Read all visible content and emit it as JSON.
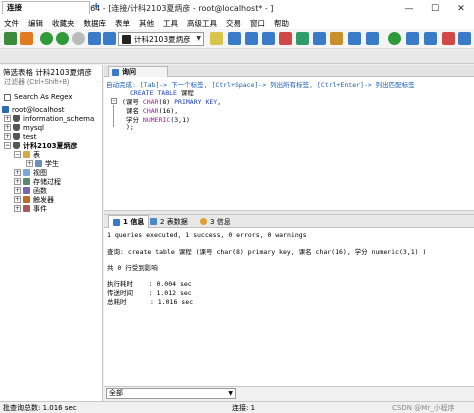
{
  "window": {
    "title": "SQLyog Ultimate 64 - [连接/计科2103夏炳彦 - root@localhost* - ]",
    "minimize": "—",
    "maximize": "☐",
    "close": "✕"
  },
  "menu": [
    "文件",
    "编辑",
    "收藏夹",
    "数据库",
    "表单",
    "其他",
    "工具",
    "高级工具",
    "交易",
    "窗口",
    "帮助"
  ],
  "toolbar": {
    "database_selected": "计科2103夏炳彦"
  },
  "connection_tab": {
    "label": "连接",
    "add": "+"
  },
  "object_browser": {
    "filter_label": "筛选表格 计科2103夏炳彦",
    "filter_placeholder": "过滤器 (Ctrl+Shift+B)",
    "regex_label": "Search As Regex",
    "connection": "root@localhost",
    "databases": [
      "information_schema",
      "mysql",
      "test",
      "计科2103夏炳彦"
    ],
    "folders": {
      "tables": "表",
      "table_student": "学生",
      "views": "视图",
      "procedures": "存储过程",
      "functions": "函数",
      "triggers": "触发器",
      "events": "事件"
    }
  },
  "editor": {
    "tab_label": "询问",
    "hint": "自动完成: [Tab]-> 下一个标签, [Ctrl+Space]-> 列出所有标签, [Ctrl+Enter]-> 列出匹配标签",
    "lines": {
      "l1_kw": "CREATE TABLE",
      "l1_rest": " 课程",
      "l2_a": "(课号 ",
      "l2_type": "CHAR",
      "l2_b": "(8) ",
      "l2_kw": "PRIMARY KEY",
      "l2_c": ",",
      "l3_a": "课名 ",
      "l3_type": "CHAR",
      "l3_b": "(16),",
      "l4_a": "学分 ",
      "l4_type": "NUMERIC",
      "l4_b": "(3,1)",
      "l5": ");"
    }
  },
  "results": {
    "tabs": [
      {
        "num": "1",
        "label": "信息"
      },
      {
        "num": "2",
        "label": "表数据"
      },
      {
        "num": "3",
        "label": "信息"
      }
    ],
    "lines": {
      "summary": "1 queries executed, 1 success, 0 errors, 0 warnings",
      "query": "查询: create table 课程 (课号 char(8) primary key, 课名 char(16), 学分 numeric(3,1) )",
      "affected": "共 0 行受到影响",
      "exec_time": "执行耗时    : 0.004 sec",
      "transfer_time": "传送时间    : 1.012 sec",
      "total_time": "总耗时      : 1.016 sec"
    },
    "footer_select": "全部"
  },
  "status": {
    "left": "批查询总数: 1.016 sec",
    "mid": "连接: 1",
    "right": "CSDN @Mr_小程序"
  },
  "colors": {
    "keyword": "#1a3fc0",
    "type": "#a020a0",
    "hint": "#1a5fb4"
  }
}
